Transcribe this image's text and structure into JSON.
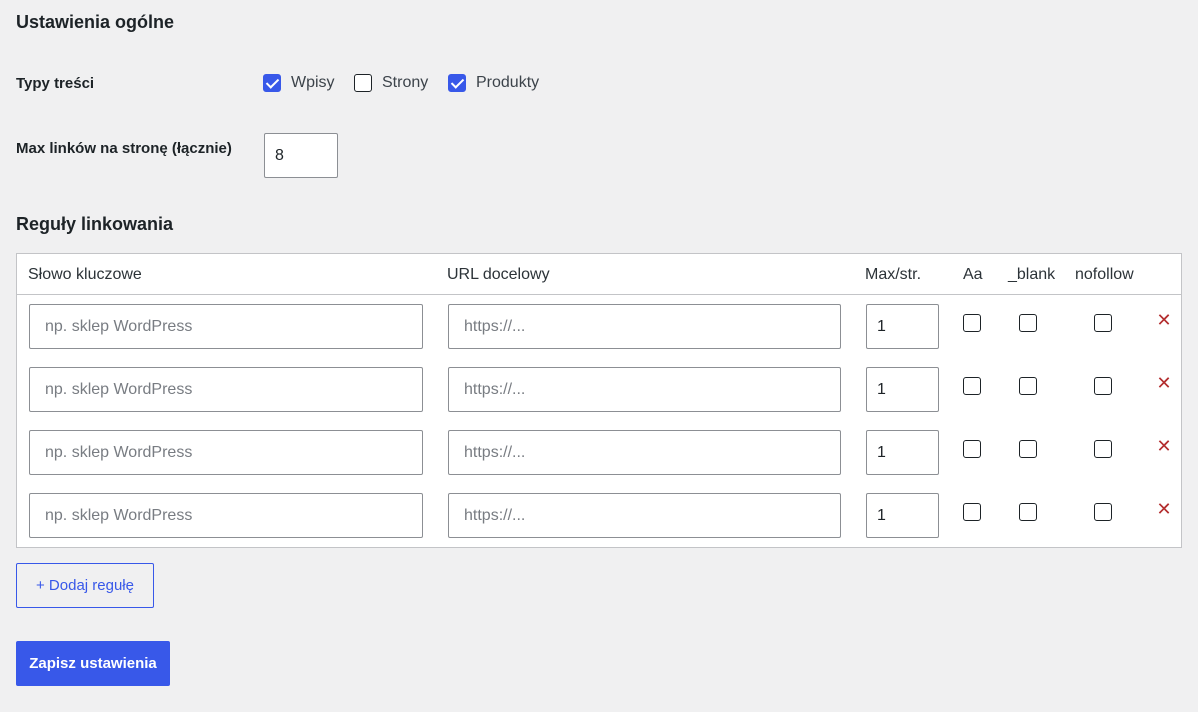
{
  "general": {
    "title": "Ustawienia ogólne",
    "content_types_label": "Typy treści",
    "content_types": [
      {
        "label": "Wpisy",
        "checked": true
      },
      {
        "label": "Strony",
        "checked": false
      },
      {
        "label": "Produkty",
        "checked": true
      }
    ],
    "max_links_label": "Max linków na stronę (łącznie)",
    "max_links_value": "8"
  },
  "rules": {
    "title": "Reguły linkowania",
    "columns": [
      "Słowo kluczowe",
      "URL docelowy",
      "Max/str.",
      "Aa",
      "_blank",
      "nofollow"
    ],
    "rows": [
      {
        "keyword_placeholder": "np. sklep WordPress",
        "url_placeholder": "https://...",
        "max": "1",
        "case": false,
        "blank": false,
        "nofollow": false
      },
      {
        "keyword_placeholder": "np. sklep WordPress",
        "url_placeholder": "https://...",
        "max": "1",
        "case": false,
        "blank": false,
        "nofollow": false
      },
      {
        "keyword_placeholder": "np. sklep WordPress",
        "url_placeholder": "https://...",
        "max": "1",
        "case": false,
        "blank": false,
        "nofollow": false
      },
      {
        "keyword_placeholder": "np. sklep WordPress",
        "url_placeholder": "https://...",
        "max": "1",
        "case": false,
        "blank": false,
        "nofollow": false
      }
    ],
    "remove_icon": "close-icon",
    "add_label": "+ Dodaj regułę"
  },
  "save_label": "Zapisz ustawienia",
  "colors": {
    "accent": "#3858e9",
    "danger": "#b32d2e",
    "background": "#f0f0f1"
  }
}
